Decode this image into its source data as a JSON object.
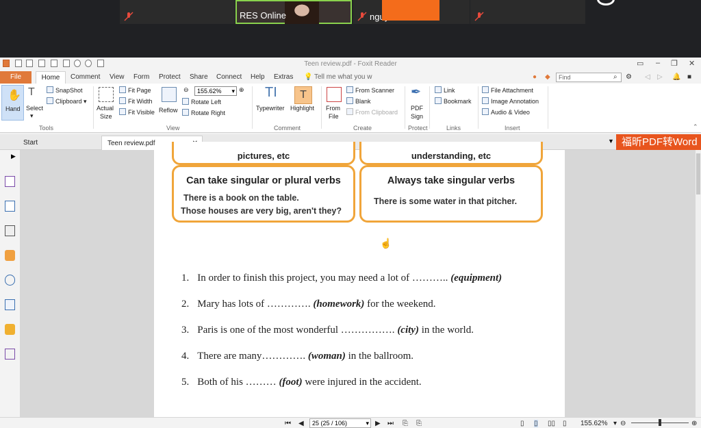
{
  "meeting": {
    "tiles": [
      {
        "name": ""
      },
      {
        "name": "RES Online"
      },
      {
        "name": "nguyenbaom..."
      },
      {
        "name": ""
      }
    ]
  },
  "app": {
    "window_title": "Teen review.pdf - Foxit Reader",
    "menu": {
      "file": "File",
      "tabs": [
        "Home",
        "Comment",
        "View",
        "Form",
        "Protect",
        "Share",
        "Connect",
        "Help",
        "Extras"
      ],
      "tell_me": "Tell me what you w",
      "find_placeholder": "Find"
    },
    "ribbon": {
      "tools": {
        "hand": "Hand",
        "select": "Select",
        "snapshot": "SnapShot",
        "clipboard": "Clipboard",
        "group": "Tools"
      },
      "view": {
        "actual_size_1": "Actual",
        "actual_size_2": "Size",
        "fit_page": "Fit Page",
        "fit_width": "Fit Width",
        "fit_visible": "Fit Visible",
        "reflow": "Reflow",
        "zoom": "155.62%",
        "rotate_left": "Rotate Left",
        "rotate_right": "Rotate Right",
        "group": "View"
      },
      "comment": {
        "typewriter": "Typewriter",
        "highlight": "Highlight",
        "group": "Comment"
      },
      "create": {
        "from_file_1": "From",
        "from_file_2": "File",
        "from_scanner": "From Scanner",
        "blank": "Blank",
        "from_clipboard": "From Clipboard",
        "group": "Create"
      },
      "protect": {
        "pdf_sign_1": "PDF",
        "pdf_sign_2": "Sign",
        "group": "Protect"
      },
      "links": {
        "link": "Link",
        "bookmark": "Bookmark",
        "group": "Links"
      },
      "insert": {
        "file_attachment": "File Attachment",
        "image_annotation": "Image Annotation",
        "audio_video": "Audio & Video",
        "group": "Insert"
      }
    },
    "doc_tabs": {
      "start": "Start",
      "current": "Teen review.pdf",
      "banner": "福昕PDF转Word"
    },
    "status": {
      "page": "25 (25 / 106)",
      "zoom": "155.62%"
    }
  },
  "document": {
    "box_left": {
      "top_text": "pictures, etc",
      "title": "Can take singular or plural verbs",
      "ex1": "There is a book on the table.",
      "ex2": "Those houses are very big, aren't they?"
    },
    "box_right": {
      "top_text": "understanding, etc",
      "title": "Always take singular verbs",
      "ex1": "There is some water in that pitcher."
    },
    "questions": [
      {
        "num": "1.",
        "text": "In order to finish this project, you may need a lot of ………..",
        "hint": "(equipment)",
        "after": ""
      },
      {
        "num": "2.",
        "text": "Mary has lots of ………….",
        "hint": "(homework)",
        "after": "for the weekend."
      },
      {
        "num": "3.",
        "text": "Paris is one of the most wonderful …………….",
        "hint": "(city)",
        "after": "in the world."
      },
      {
        "num": "4.",
        "text": "There are many………….",
        "hint": "(woman)",
        "after": "in the ballroom."
      },
      {
        "num": "5.",
        "text": "Both of his ………",
        "hint": "(foot)",
        "after": "were injured in the accident."
      }
    ]
  }
}
